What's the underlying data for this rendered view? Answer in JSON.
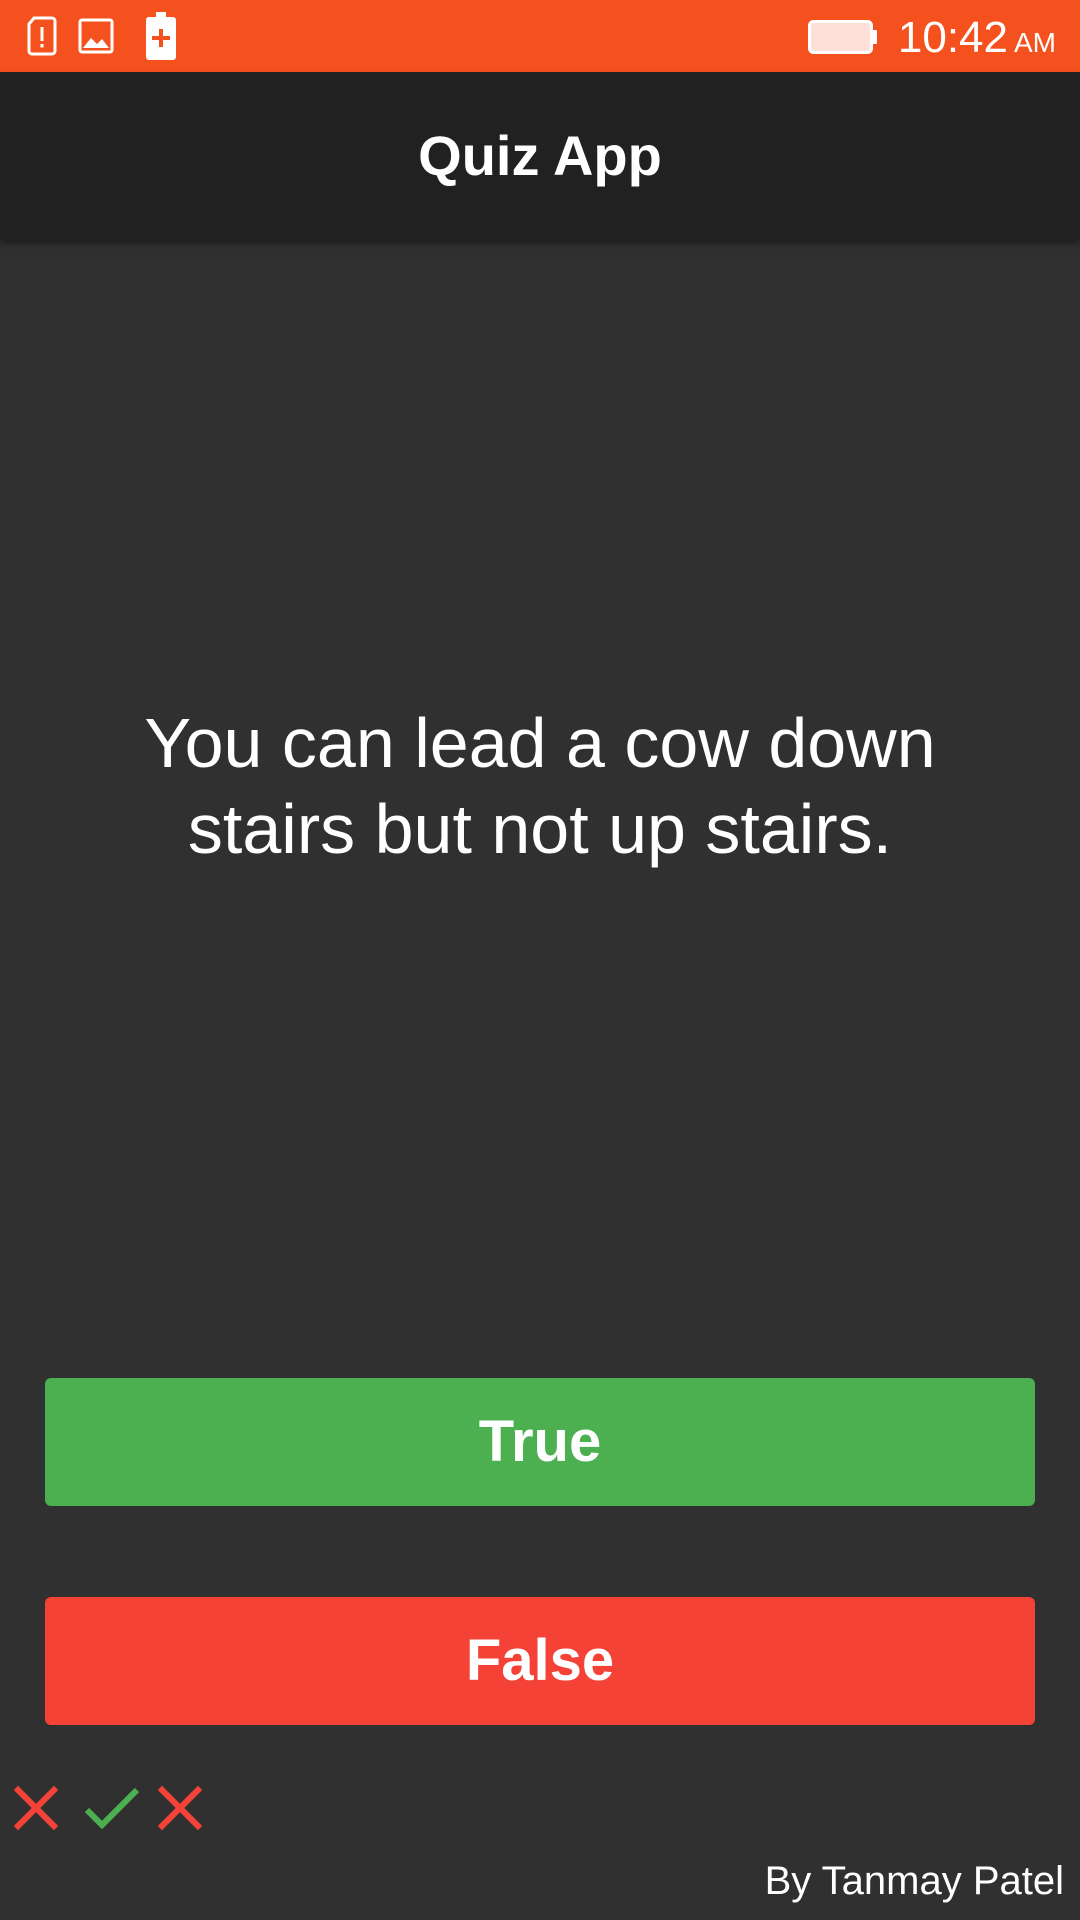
{
  "status_bar": {
    "time": "10:42",
    "ampm": "AM",
    "icons": [
      "sd-card-alert-icon",
      "image-icon",
      "battery-charging-icon",
      "battery-icon"
    ],
    "color": "#f4511e"
  },
  "app_bar": {
    "title": "Quiz App",
    "color": "#212121"
  },
  "question": {
    "text": "You can lead a cow down stairs but not up stairs."
  },
  "answers": {
    "true_label": "True",
    "false_label": "False",
    "true_color": "#4caf50",
    "false_color": "#f44336"
  },
  "score_marks": [
    "wrong",
    "correct",
    "wrong"
  ],
  "footer": {
    "credit": "By Tanmay Patel"
  }
}
